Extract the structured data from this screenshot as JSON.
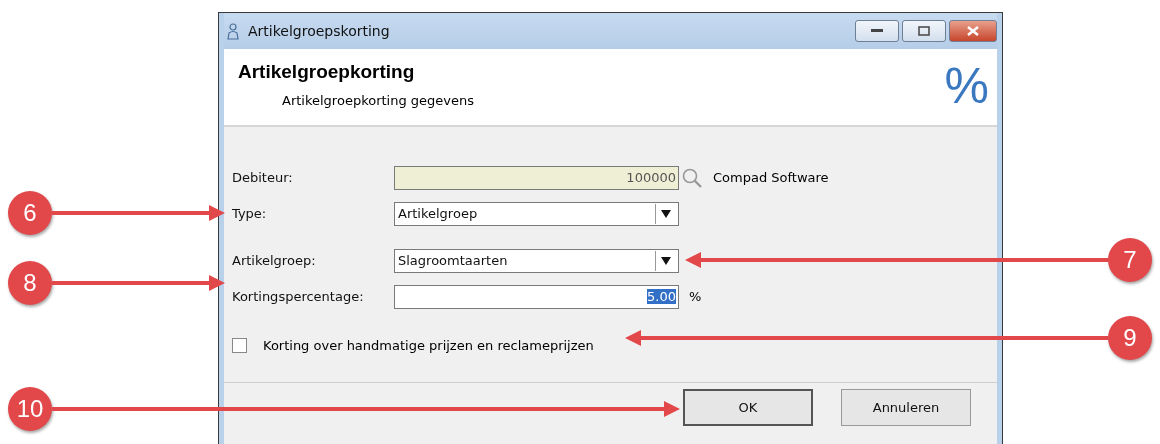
{
  "window": {
    "title": "Artikelgroepskorting"
  },
  "header": {
    "title": "Artikelgroepkorting",
    "subtitle": "Artikelgroepkorting gegevens",
    "symbol": "%"
  },
  "fields": [
    {
      "kind": "lookup",
      "label": "Debiteur:",
      "value": "100000",
      "name": "Compad Software"
    },
    {
      "kind": "dropdown",
      "label": "Type:",
      "value": "Artikelgroep"
    },
    {
      "kind": "dropdown",
      "label": "Artikelgroep:",
      "value": "Slagroomtaarten"
    },
    {
      "kind": "number",
      "label": "Kortingspercentage:",
      "value": "5.00",
      "unit": "%",
      "selected": true
    }
  ],
  "checkbox": {
    "label": "Korting over handmatige prijzen en reclameprijzen",
    "checked": false
  },
  "buttons": [
    {
      "label": "OK",
      "default": true
    },
    {
      "label": "Annuleren",
      "default": false
    }
  ],
  "callouts": [
    {
      "label": "6"
    },
    {
      "label": "7"
    },
    {
      "label": "8"
    },
    {
      "label": "9"
    },
    {
      "label": "10"
    }
  ]
}
